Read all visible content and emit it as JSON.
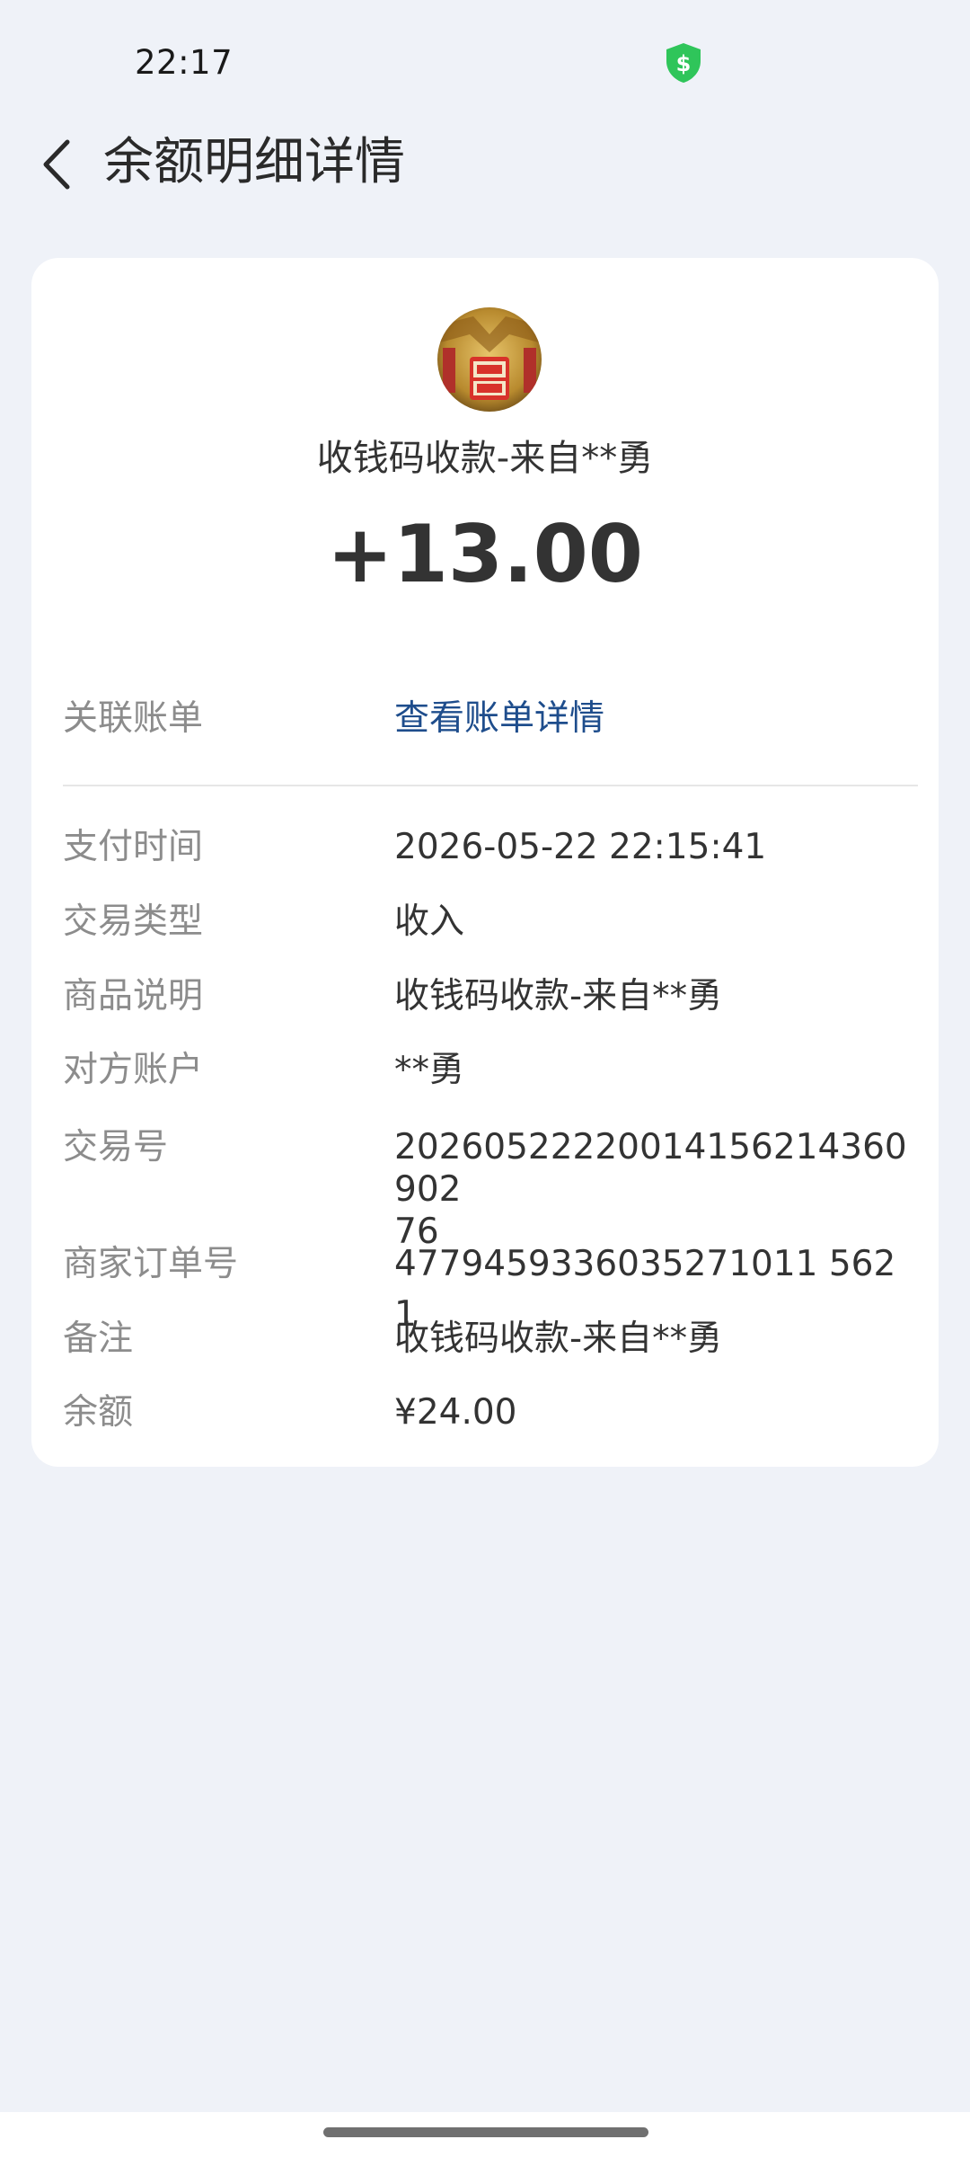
{
  "status_bar": {
    "time": "22:17",
    "security_icon": "shield-dollar-icon",
    "security_color": "#2fc55a"
  },
  "header": {
    "back_icon": "chevron-left-icon",
    "title": "余额明细详情"
  },
  "transaction": {
    "avatar_icon": "merchant-avatar",
    "title": "收钱码收款-来自**勇",
    "amount": "+13.00",
    "linked_bill_label": "关联账单",
    "linked_bill_link": "查看账单详情",
    "link_color": "#1e4d8c",
    "details": [
      {
        "label": "支付时间",
        "value": "2026-05-22 22:15:41"
      },
      {
        "label": "交易类型",
        "value": "收入"
      },
      {
        "label": "商品说明",
        "value": "收钱码收款-来自**勇"
      },
      {
        "label": "对方账户",
        "value": "**勇"
      },
      {
        "label": "交易号",
        "value": "20260522220014156214360902\n76"
      },
      {
        "label": "商家订单号",
        "value": "4779459336035271011 5621"
      },
      {
        "label": "备注",
        "value": "收钱码收款-来自**勇"
      },
      {
        "label": "余额",
        "value": "¥24.00"
      }
    ]
  }
}
